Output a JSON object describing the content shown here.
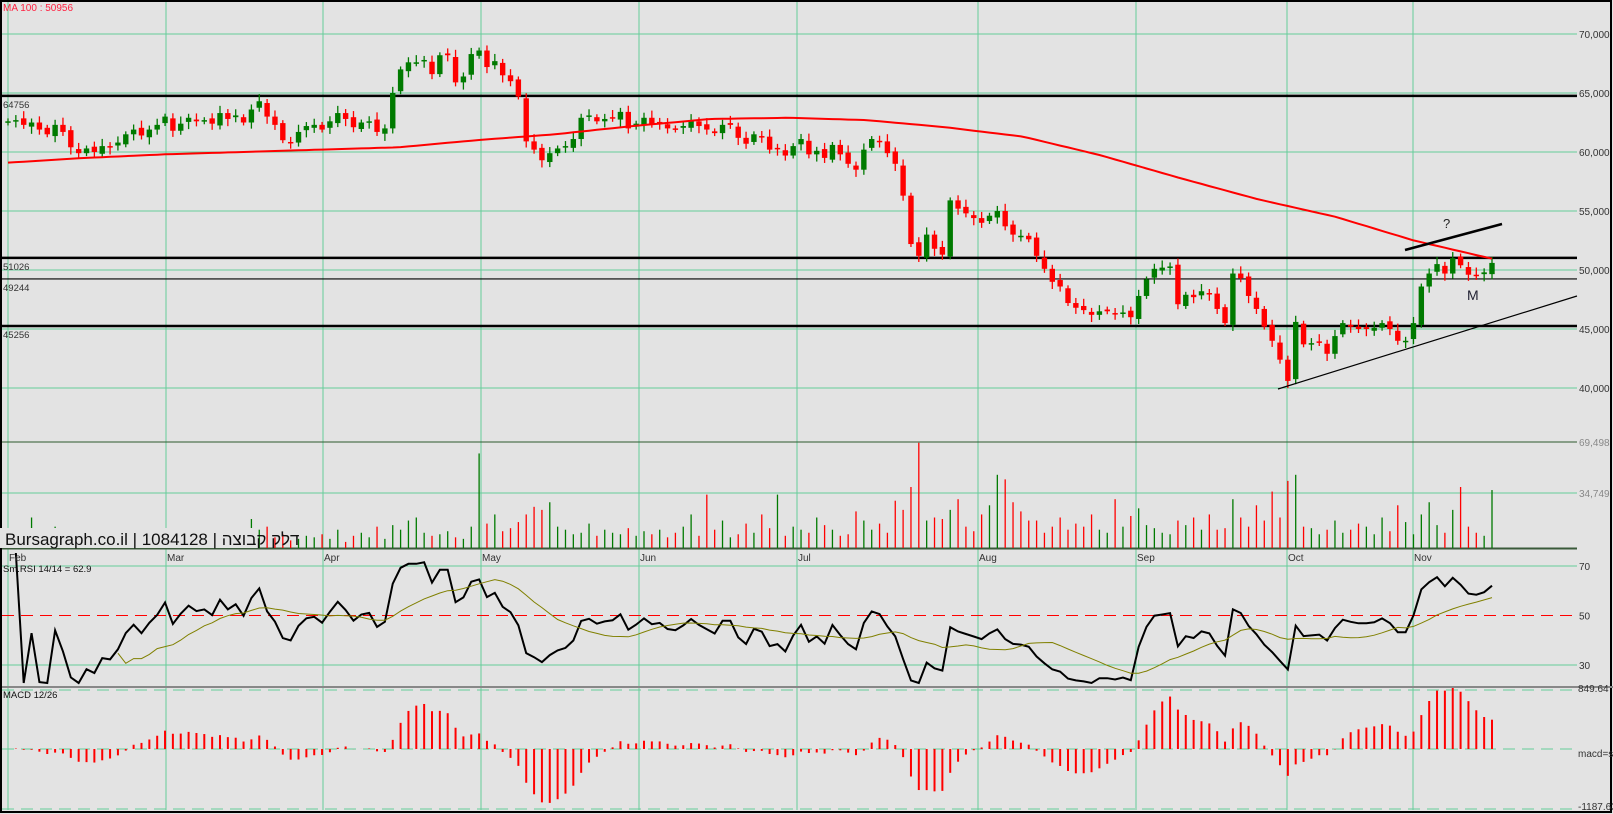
{
  "chart_data": [
    {
      "type": "candlestick",
      "ma_label": "MA 100 : 50956",
      "watermark": "Bursagraph.co.il | 1084128 | דלק קבוצה",
      "months": [
        "Feb",
        "Mar",
        "Apr",
        "May",
        "Jun",
        "Jul",
        "Aug",
        "Sep",
        "Oct",
        "Nov"
      ],
      "y_ticks": [
        "70,000",
        "65,000",
        "60,000",
        "55,000",
        "50,000",
        "45,000",
        "40,000"
      ],
      "ylim": [
        37000,
        73000
      ],
      "levels": [
        {
          "label": "64756",
          "value": 64756,
          "weight": "thick"
        },
        {
          "label": "51026",
          "value": 51026,
          "weight": "thick"
        },
        {
          "label": "49244",
          "value": 49244,
          "weight": "thin"
        },
        {
          "label": "45256",
          "value": 45256,
          "weight": "thick"
        }
      ],
      "annotations": [
        "?",
        "M"
      ],
      "closes": [
        62600,
        62700,
        62300,
        62500,
        61900,
        61500,
        62300,
        61700,
        60400,
        59900,
        60300,
        60000,
        60500,
        60400,
        60800,
        61500,
        61900,
        61400,
        61900,
        62300,
        63000,
        61800,
        62400,
        62900,
        62600,
        62700,
        62400,
        63300,
        62800,
        63100,
        62500,
        63600,
        64300,
        63000,
        62300,
        61000,
        60800,
        61700,
        62200,
        62300,
        61900,
        62600,
        63300,
        62800,
        62100,
        62500,
        62600,
        61700,
        62000,
        65000,
        67000,
        67600,
        67600,
        67800,
        66600,
        68200,
        68200,
        65900,
        66400,
        68300,
        68600,
        67200,
        67700,
        66500,
        66000,
        64700,
        60900,
        60200,
        59300,
        59900,
        60300,
        60500,
        61100,
        62900,
        63100,
        62600,
        62800,
        62900,
        63400,
        62000,
        62400,
        62900,
        62400,
        62500,
        62000,
        61900,
        62200,
        62600,
        62200,
        61900,
        61600,
        62300,
        62300,
        61200,
        60700,
        61500,
        61300,
        60200,
        60300,
        59700,
        60500,
        61100,
        59800,
        60100,
        59500,
        60600,
        59800,
        59000,
        58500,
        60200,
        61100,
        60900,
        59900,
        59000,
        56300,
        52200,
        51200,
        53000,
        51800,
        51300,
        55900,
        55200,
        54800,
        54400,
        54000,
        54600,
        55000,
        53700,
        53000,
        52900,
        52600,
        51200,
        50100,
        49000,
        48600,
        47200,
        46800,
        46600,
        46200,
        46500,
        46500,
        46300,
        46400,
        46000,
        47800,
        49200,
        50100,
        50200,
        50300,
        47100,
        47900,
        47700,
        48200,
        48000,
        46700,
        45500,
        49700,
        49300,
        47800,
        46700,
        45200,
        44000,
        42400,
        40600,
        45600,
        43700,
        43800,
        43900,
        42900,
        44400,
        45500,
        45200,
        45000,
        45000,
        45100,
        45500,
        45000,
        44000,
        44000,
        45500,
        48600,
        49700,
        50500,
        49700,
        51000,
        50400,
        49600,
        49500,
        49800,
        50600
      ],
      "ma100_points": [
        59100,
        59500,
        59800,
        60000,
        60200,
        60400,
        61000,
        61500,
        62200,
        62800,
        62900,
        62700,
        62100,
        61300,
        59700,
        57800,
        56000,
        54500,
        52500,
        50956
      ],
      "colors": {
        "up": "#007a00",
        "down": "#ff0000",
        "ma": "#ff0000",
        "grid": "#66cc99",
        "background": "#e3e3e3"
      }
    },
    {
      "type": "bar",
      "name": "volume",
      "y_ticks": [
        "69,498",
        "34,749"
      ],
      "ylim": [
        0,
        69498
      ],
      "values": [
        8000,
        12000,
        6000,
        20000,
        9000,
        5000,
        14000,
        7000,
        10000,
        4000,
        6000,
        8000,
        5000,
        7000,
        12000,
        9000,
        6000,
        4000,
        5000,
        8000,
        10000,
        6000,
        5000,
        9000,
        4000,
        7000,
        6000,
        5000,
        8000,
        4000,
        6000,
        19000,
        12000,
        14000,
        7000,
        9000,
        5000,
        6000,
        8000,
        7000,
        9000,
        6000,
        12000,
        4000,
        8000,
        10000,
        7000,
        14000,
        6000,
        15000,
        12000,
        18000,
        20000,
        10000,
        8000,
        9000,
        11000,
        7000,
        6000,
        14000,
        62000,
        16000,
        22000,
        11000,
        13000,
        17000,
        22000,
        27000,
        25000,
        30000,
        14000,
        12000,
        9000,
        10000,
        16000,
        8000,
        12000,
        10000,
        9000,
        13000,
        8000,
        11000,
        9000,
        12000,
        7000,
        10000,
        14000,
        22000,
        8000,
        35000,
        12000,
        18000,
        7000,
        9000,
        16000,
        10000,
        22000,
        13000,
        35000,
        8000,
        14000,
        12000,
        10000,
        20000,
        15000,
        12000,
        8000,
        9000,
        24000,
        18000,
        12000,
        16000,
        10000,
        31000,
        25000,
        40000,
        69000,
        18000,
        20000,
        19000,
        25000,
        32000,
        14000,
        11000,
        22000,
        28000,
        48000,
        45000,
        30000,
        24000,
        18000,
        18000,
        10000,
        14000,
        20000,
        12000,
        16000,
        14000,
        22000,
        12000,
        10000,
        32000,
        14000,
        21000,
        26000,
        15000,
        13000,
        10000,
        9000,
        18000,
        15000,
        20000,
        12000,
        22000,
        12000,
        13000,
        32000,
        20000,
        14000,
        28000,
        18000,
        37000,
        20000,
        44000,
        48000,
        14000,
        13000,
        9000,
        12000,
        18000,
        10000,
        12000,
        16000,
        14000,
        9000,
        20000,
        11000,
        28000,
        17000,
        9000,
        22000,
        30000,
        15000,
        10000,
        25000,
        40000,
        14000,
        10000,
        8000,
        38000
      ]
    },
    {
      "type": "line",
      "label": "Sm.RSI 14/14 = 62.9",
      "y_ticks": [
        "70",
        "50",
        "30"
      ],
      "ylim": [
        30,
        70
      ],
      "colors": {
        "rsi": "#000000",
        "signal": "#808000",
        "midline": "#ff0000"
      }
    },
    {
      "type": "bar",
      "label": "MACD 12/26",
      "y_ticks": [
        "849.64",
        "macd=s",
        "-1187.63"
      ],
      "ylim": [
        -1187.63,
        849.64
      ],
      "colors": {
        "histogram": "#ff0000"
      }
    }
  ]
}
